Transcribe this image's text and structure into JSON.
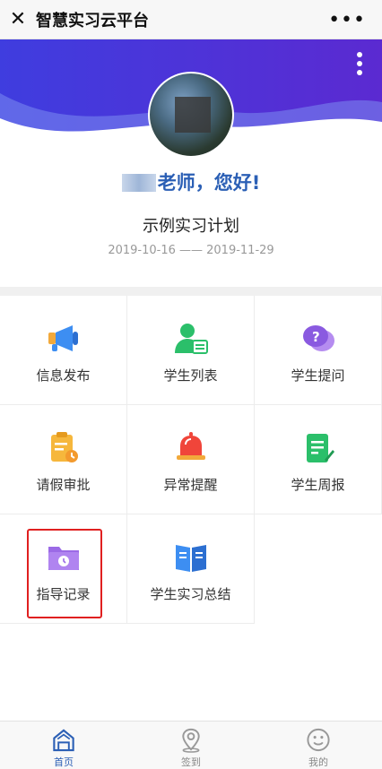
{
  "window": {
    "title": "智慧实习云平台",
    "close_icon": "close-icon",
    "more_icon": "more-horizontal-icon"
  },
  "header": {
    "greeting_suffix": "老师，您好!",
    "plan_name": "示例实习计划",
    "date_range": "2019-10-16 —— 2019-11-29",
    "colors": {
      "banner_start": "#3f3ddf",
      "banner_end": "#5b2ad1",
      "greeting": "#2b5fb5"
    }
  },
  "menu": {
    "items": [
      {
        "label": "信息发布",
        "icon": "megaphone-icon"
      },
      {
        "label": "学生列表",
        "icon": "student-list-icon"
      },
      {
        "label": "学生提问",
        "icon": "question-bubble-icon"
      },
      {
        "label": "请假审批",
        "icon": "leave-approval-icon"
      },
      {
        "label": "异常提醒",
        "icon": "alarm-bell-icon"
      },
      {
        "label": "学生周报",
        "icon": "weekly-report-icon"
      },
      {
        "label": "指导记录",
        "icon": "folder-clock-icon"
      },
      {
        "label": "学生实习总结",
        "icon": "book-icon"
      }
    ]
  },
  "tabbar": {
    "tabs": [
      {
        "label": "首页",
        "icon": "home-icon",
        "active": true
      },
      {
        "label": "签到",
        "icon": "location-pin-icon",
        "active": false
      },
      {
        "label": "我的",
        "icon": "smiley-face-icon",
        "active": false
      }
    ]
  }
}
